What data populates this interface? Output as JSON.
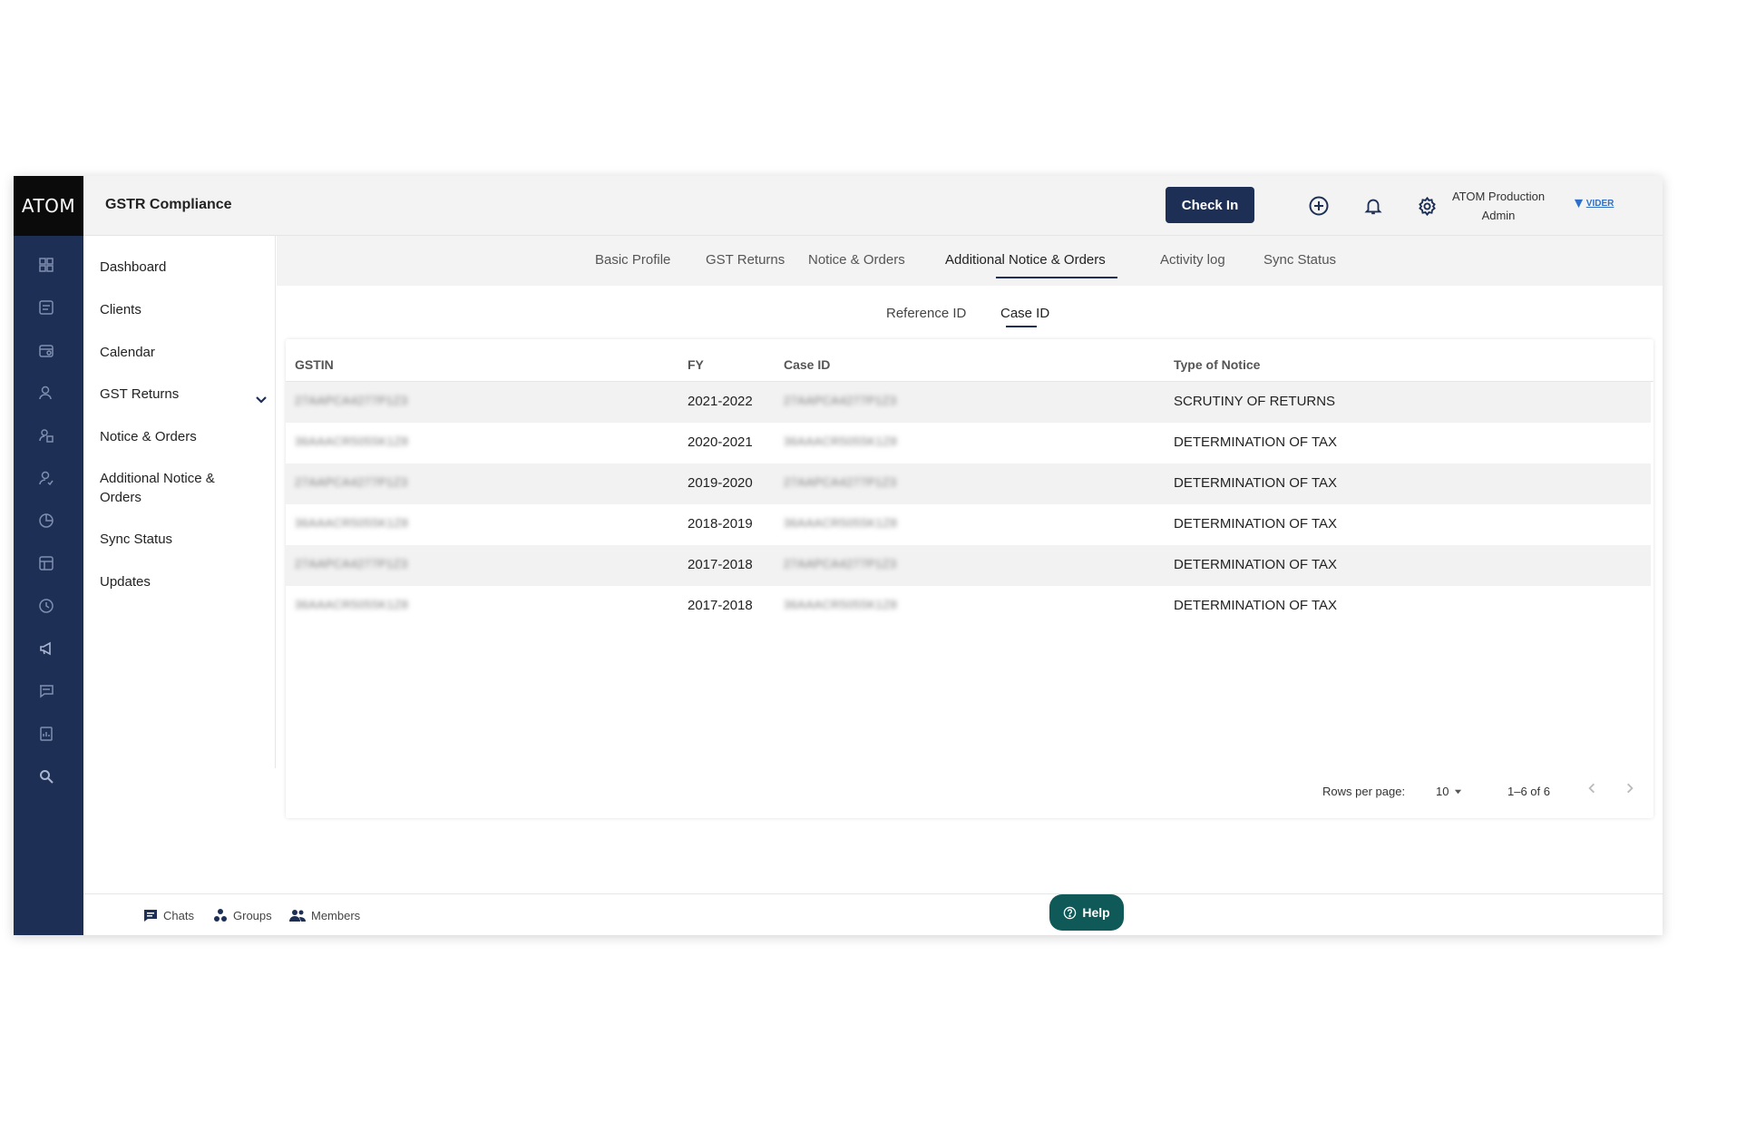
{
  "app": {
    "logo": "ATOM",
    "title": "GSTR Compliance",
    "checkin_label": "Check In",
    "user_name": "ATOM Production",
    "user_role": "Admin",
    "brand_text": "VIDER",
    "accent": "#1d2f55",
    "help_color": "#0f5a58"
  },
  "rail_icons": [
    "dashboard-icon",
    "clients-icon",
    "calendar-icon",
    "user-icon",
    "tasks-icon",
    "user-check-icon",
    "chart-pie-icon",
    "table-icon",
    "timer-icon",
    "megaphone-icon",
    "chat-icon",
    "report-icon",
    "search-icon"
  ],
  "sidebar": {
    "items": [
      {
        "label": "Dashboard"
      },
      {
        "label": "Clients"
      },
      {
        "label": "Calendar"
      },
      {
        "label": "GST Returns"
      },
      {
        "label": "Notice & Orders"
      },
      {
        "label": "Additional Notice & Orders"
      },
      {
        "label": "Sync Status"
      },
      {
        "label": "Updates"
      }
    ]
  },
  "tabs": [
    {
      "label": "Basic Profile"
    },
    {
      "label": "GST Returns"
    },
    {
      "label": "Notice & Orders"
    },
    {
      "label": "Additional Notice & Orders",
      "active": true
    },
    {
      "label": "Activity log"
    },
    {
      "label": "Sync Status"
    }
  ],
  "subtabs": [
    {
      "label": "Reference ID"
    },
    {
      "label": "Case ID",
      "active": true
    }
  ],
  "table": {
    "headers": {
      "gstin": "GSTIN",
      "fy": "FY",
      "case_id": "Case ID",
      "type": "Type of Notice"
    },
    "rows": [
      {
        "gstin": "27AAPCA4277P1Z3",
        "fy": "2021-2022",
        "case_id": "27AAPCA4277P1Z3",
        "type": "SCRUTINY OF RETURNS"
      },
      {
        "gstin": "36AAACR5055K1Z8",
        "fy": "2020-2021",
        "case_id": "36AAACR5055K1Z8",
        "type": "DETERMINATION OF TAX"
      },
      {
        "gstin": "27AAPCA4277P1Z3",
        "fy": "2019-2020",
        "case_id": "27AAPCA4277P1Z3",
        "type": "DETERMINATION OF TAX"
      },
      {
        "gstin": "36AAACR5055K1Z8",
        "fy": "2018-2019",
        "case_id": "36AAACR5055K1Z8",
        "type": "DETERMINATION OF TAX"
      },
      {
        "gstin": "27AAPCA4277P1Z3",
        "fy": "2017-2018",
        "case_id": "27AAPCA4277P1Z3",
        "type": "DETERMINATION OF TAX"
      },
      {
        "gstin": "36AAACR5055K1Z8",
        "fy": "2017-2018",
        "case_id": "36AAACR5055K1Z8",
        "type": "DETERMINATION OF TAX"
      }
    ]
  },
  "pagination": {
    "rows_label": "Rows per page:",
    "rows_value": "10",
    "range": "1–6 of 6"
  },
  "bottom": {
    "chats": "Chats",
    "groups": "Groups",
    "members": "Members",
    "help": "Help"
  }
}
